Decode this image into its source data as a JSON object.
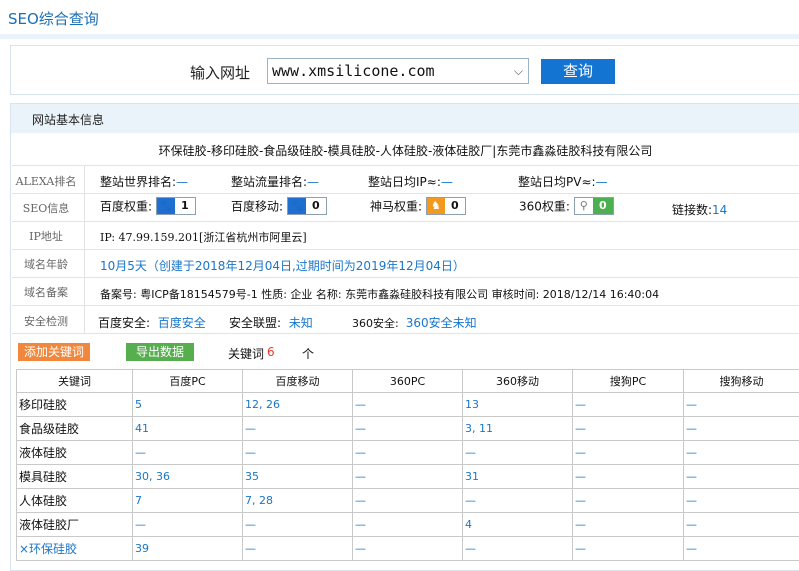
{
  "page_title": "SEO综合查询",
  "query": {
    "label": "输入网址",
    "url": "www.xmsilicone.com",
    "button": "查询"
  },
  "section": {
    "title": "网站基本信息"
  },
  "site_title": "环保硅胶-移印硅胶-食品级硅胶-模具硅胶-人体硅胶-液体硅胶厂|东莞市鑫淼硅胶科技有限公司",
  "rows": {
    "alexa": {
      "label": "ALEXA排名",
      "world_rank_label": "整站世界排名:",
      "world_rank": "—",
      "traffic_rank_label": "整站流量排名:",
      "traffic_rank": "—",
      "daily_ip_label": "整站日均IP≈:",
      "daily_ip": "—",
      "daily_pv_label": "整站日均PV≈:",
      "daily_pv": "—"
    },
    "seo": {
      "label": "SEO信息",
      "baidu_weight_label": "百度权重:",
      "baidu_weight": "1",
      "baidu_mobile_label": "百度移动:",
      "baidu_mobile": "0",
      "shenma_label": "神马权重:",
      "shenma": "0",
      "s360_label": "360权重:",
      "s360": "0",
      "links_label": "链接数:",
      "links": "14"
    },
    "ip": {
      "label": "IP地址",
      "value": "IP: 47.99.159.201[浙江省杭州市阿里云]"
    },
    "age": {
      "label": "域名年龄",
      "value": "10月5天（创建于2018年12月04日,过期时间为2019年12月04日）"
    },
    "icp": {
      "label": "域名备案",
      "value": "备案号: 粤ICP备18154579号-1 性质: 企业 名称: 东莞市鑫淼硅胶科技有限公司 审核时间: 2018/12/14 16:40:04"
    },
    "security": {
      "label": "安全检测",
      "baidu_label": "百度安全:",
      "baidu": "百度安全",
      "alliance_label": "安全联盟:",
      "alliance": "未知",
      "s360_label": "360安全:",
      "s360": "360安全未知"
    }
  },
  "actions": {
    "add_keyword": "添加关键词",
    "export": "导出数据",
    "keyword_label": "关键词",
    "keyword_count": "6",
    "keyword_unit": "个"
  },
  "table": {
    "headers": [
      "关键词",
      "百度PC",
      "百度移动",
      "360PC",
      "360移动",
      "搜狗PC",
      "搜狗移动"
    ],
    "rows": [
      [
        "移印硅胶",
        "5",
        "12, 26",
        "—",
        "13",
        "—",
        "—"
      ],
      [
        "食品级硅胶",
        "41",
        "—",
        "—",
        "3, 11",
        "—",
        "—"
      ],
      [
        "液体硅胶",
        "—",
        "—",
        "—",
        "—",
        "—",
        "—"
      ],
      [
        "模具硅胶",
        "30, 36",
        "35",
        "—",
        "31",
        "—",
        "—"
      ],
      [
        "人体硅胶",
        "7",
        "7, 28",
        "—",
        "—",
        "—",
        "—"
      ],
      [
        "液体硅胶厂",
        "—",
        "—",
        "—",
        "4",
        "—",
        "—"
      ],
      [
        "×环保硅胶",
        "39",
        "—",
        "—",
        "—",
        "—",
        "—"
      ]
    ]
  },
  "colors": {
    "accent": "#1375d1",
    "link": "#1a76c9",
    "add_button": "#f0873c",
    "export_button": "#56ae4f",
    "count": "#e8362a",
    "paw_icon": "#1f6fd0",
    "shenma_icon": "#f39a1e",
    "s360_icon": "#4caf50"
  },
  "icons": {
    "baidu_weight": "paw-icon",
    "baidu_mobile": "paw-icon",
    "shenma": "horse-icon",
    "s360": "magnifier-icon"
  }
}
